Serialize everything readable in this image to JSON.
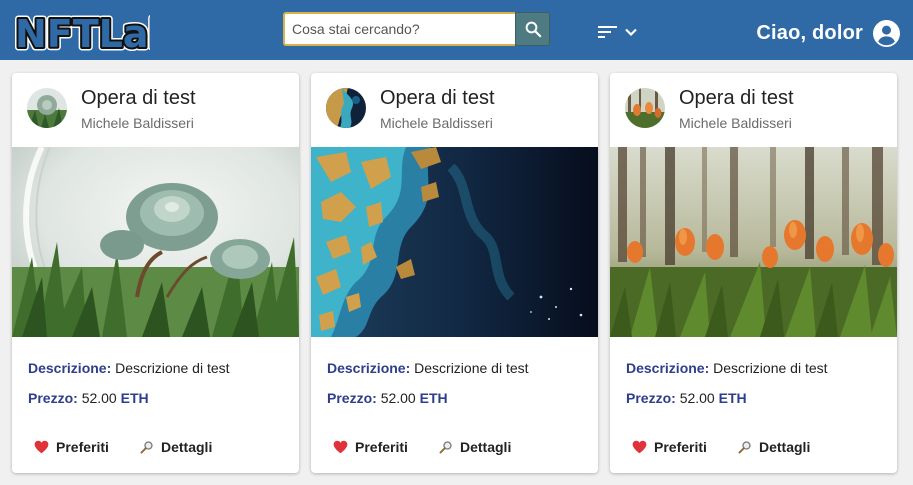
{
  "header": {
    "logo_text": "NFTLab",
    "search": {
      "placeholder": "Cosa stai cercando?",
      "value": ""
    },
    "user_greeting": "Ciao, dolor"
  },
  "colors": {
    "appbar": "#2f6aa6",
    "search_border": "#d9b24a",
    "search_button": "#4e7b82",
    "label": "#2c3e8c"
  },
  "cards": [
    {
      "title": "Opera di test",
      "author": "Michele Baldisseri",
      "image": "succulent-terrarium",
      "description_label": "Descrizione:",
      "description": "Descrizione di test",
      "price_label": "Prezzo:",
      "price": "52.00",
      "currency": "ETH",
      "fav_label": "Preferiti",
      "details_label": "Dettagli"
    },
    {
      "title": "Opera di test",
      "author": "Michele Baldisseri",
      "image": "ocean-satellite",
      "description_label": "Descrizione:",
      "description": "Descrizione di test",
      "price_label": "Prezzo:",
      "price": "52.00",
      "currency": "ETH",
      "fav_label": "Preferiti",
      "details_label": "Dettagli"
    },
    {
      "title": "Opera di test",
      "author": "Michele Baldisseri",
      "image": "tulip-field",
      "description_label": "Descrizione:",
      "description": "Descrizione di test",
      "price_label": "Prezzo:",
      "price": "52.00",
      "currency": "ETH",
      "fav_label": "Preferiti",
      "details_label": "Dettagli"
    }
  ]
}
